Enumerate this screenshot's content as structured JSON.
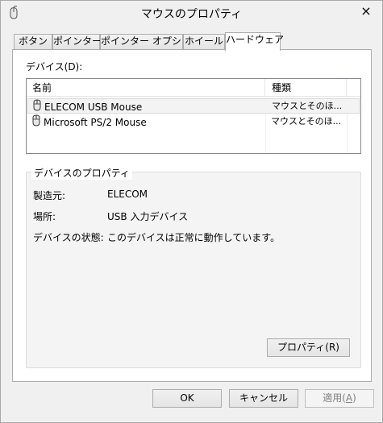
{
  "window": {
    "title": "マウスのプロパティ",
    "close_label": "×"
  },
  "tabs": [
    {
      "label": "ボタン"
    },
    {
      "label": "ポインター"
    },
    {
      "label": "ポインター オプション"
    },
    {
      "label": "ホイール"
    },
    {
      "label": "ハードウェア",
      "active": true
    }
  ],
  "hardware": {
    "devices_label": "デバイス(D):",
    "columns": {
      "name": "名前",
      "type": "種類"
    },
    "devices": [
      {
        "name": "ELECOM USB Mouse",
        "type": "マウスとそのほ...",
        "icon": "mouse-icon",
        "selected": true
      },
      {
        "name": "Microsoft PS/2 Mouse",
        "type": "マウスとそのほ...",
        "icon": "mouse-icon",
        "selected": false
      }
    ],
    "properties": {
      "title": "デバイスのプロパティ",
      "manufacturer_label": "製造元:",
      "manufacturer_value": "ELECOM",
      "location_label": "場所:",
      "location_value": "USB 入力デバイス",
      "status_label": "デバイスの状態:",
      "status_value": "このデバイスは正常に動作しています。"
    },
    "properties_button": "プロパティ(R)"
  },
  "footer": {
    "ok": "OK",
    "cancel": "キャンセル",
    "apply_prefix": "適用(",
    "apply_mnemonic": "A",
    "apply_suffix": ")"
  },
  "colors": {
    "window_bg": "#f0f0f0",
    "panel_bg": "#ffffff",
    "disabled_text": "#838383"
  }
}
